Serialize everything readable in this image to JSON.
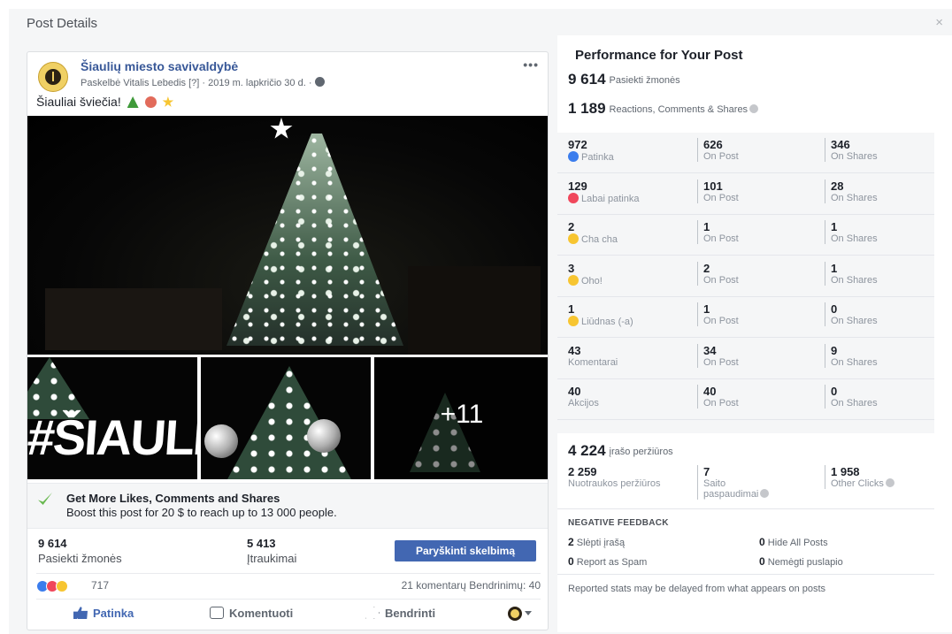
{
  "dialog": {
    "title": "Post Details",
    "close": "×"
  },
  "post": {
    "page_name": "Šiaulių miesto savivaldybė",
    "meta": "Paskelbė Vitalis Lebedis [?] · 2019 m. lapkričio 30 d. ·",
    "more": "•••",
    "text": "Šiauliai šviečia!",
    "photos_more": "+11",
    "thumb_text": "#ŠIAULIAI",
    "boost": {
      "title": "Get More Likes, Comments and Shares",
      "subtitle": "Boost this post for 20 $ to reach up to 13 000 people."
    },
    "stats": [
      {
        "value": "9 614",
        "label": "Pasiekti žmonės"
      },
      {
        "value": "5 413",
        "label": "Įtraukimai"
      }
    ],
    "boost_button": "Paryškinti skelbimą",
    "reaction_count": "717",
    "comments_shares": "21 komentarų  Bendrinimų: 40",
    "actions": {
      "like": "Patinka",
      "comment": "Komentuoti",
      "share": "Bendrinti"
    }
  },
  "performance": {
    "title": "Performance for Your Post",
    "reach": {
      "value": "9 614",
      "label": "Pasiekti žmonės"
    },
    "engagement": {
      "value": "1 189",
      "label": "Reactions, Comments & Shares"
    },
    "rows": [
      {
        "icon": "like-reaction-icon",
        "n1": "972",
        "l1": "Patinka",
        "n2": "626",
        "l2": "On Post",
        "n3": "346",
        "l3": "On Shares"
      },
      {
        "icon": "love-reaction-icon",
        "n1": "129",
        "l1": "Labai patinka",
        "n2": "101",
        "l2": "On Post",
        "n3": "28",
        "l3": "On Shares"
      },
      {
        "icon": "haha-reaction-icon",
        "n1": "2",
        "l1": "Cha cha",
        "n2": "1",
        "l2": "On Post",
        "n3": "1",
        "l3": "On Shares"
      },
      {
        "icon": "wow-reaction-icon",
        "n1": "3",
        "l1": "Oho!",
        "n2": "2",
        "l2": "On Post",
        "n3": "1",
        "l3": "On Shares"
      },
      {
        "icon": "sad-reaction-icon",
        "n1": "1",
        "l1": "Liūdnas (-a)",
        "n2": "1",
        "l2": "On Post",
        "n3": "0",
        "l3": "On Shares"
      },
      {
        "icon": "",
        "n1": "43",
        "l1": "Komentarai",
        "n2": "34",
        "l2": "On Post",
        "n3": "9",
        "l3": "On Shares"
      },
      {
        "icon": "",
        "n1": "40",
        "l1": "Akcijos",
        "n2": "40",
        "l2": "On Post",
        "n3": "0",
        "l3": "On Shares"
      }
    ],
    "views": {
      "value": "4 224",
      "label": "įrašo peržiūros",
      "cols": [
        {
          "n": "2 259",
          "l": "Nuotraukos peržiūros"
        },
        {
          "n": "7",
          "l": "Saito",
          "l2": "paspaudimai"
        },
        {
          "n": "1 958",
          "l": "Other Clicks"
        }
      ]
    },
    "negative": {
      "title": "NEGATIVE FEEDBACK",
      "items": [
        {
          "n": "2",
          "l": "Slėpti įrašą"
        },
        {
          "n": "0",
          "l": "Hide All Posts"
        },
        {
          "n": "0",
          "l": "Report as Spam"
        },
        {
          "n": "0",
          "l": "Nemėgti puslapio"
        }
      ]
    },
    "disclaimer": "Reported stats may be delayed from what appears on posts"
  }
}
